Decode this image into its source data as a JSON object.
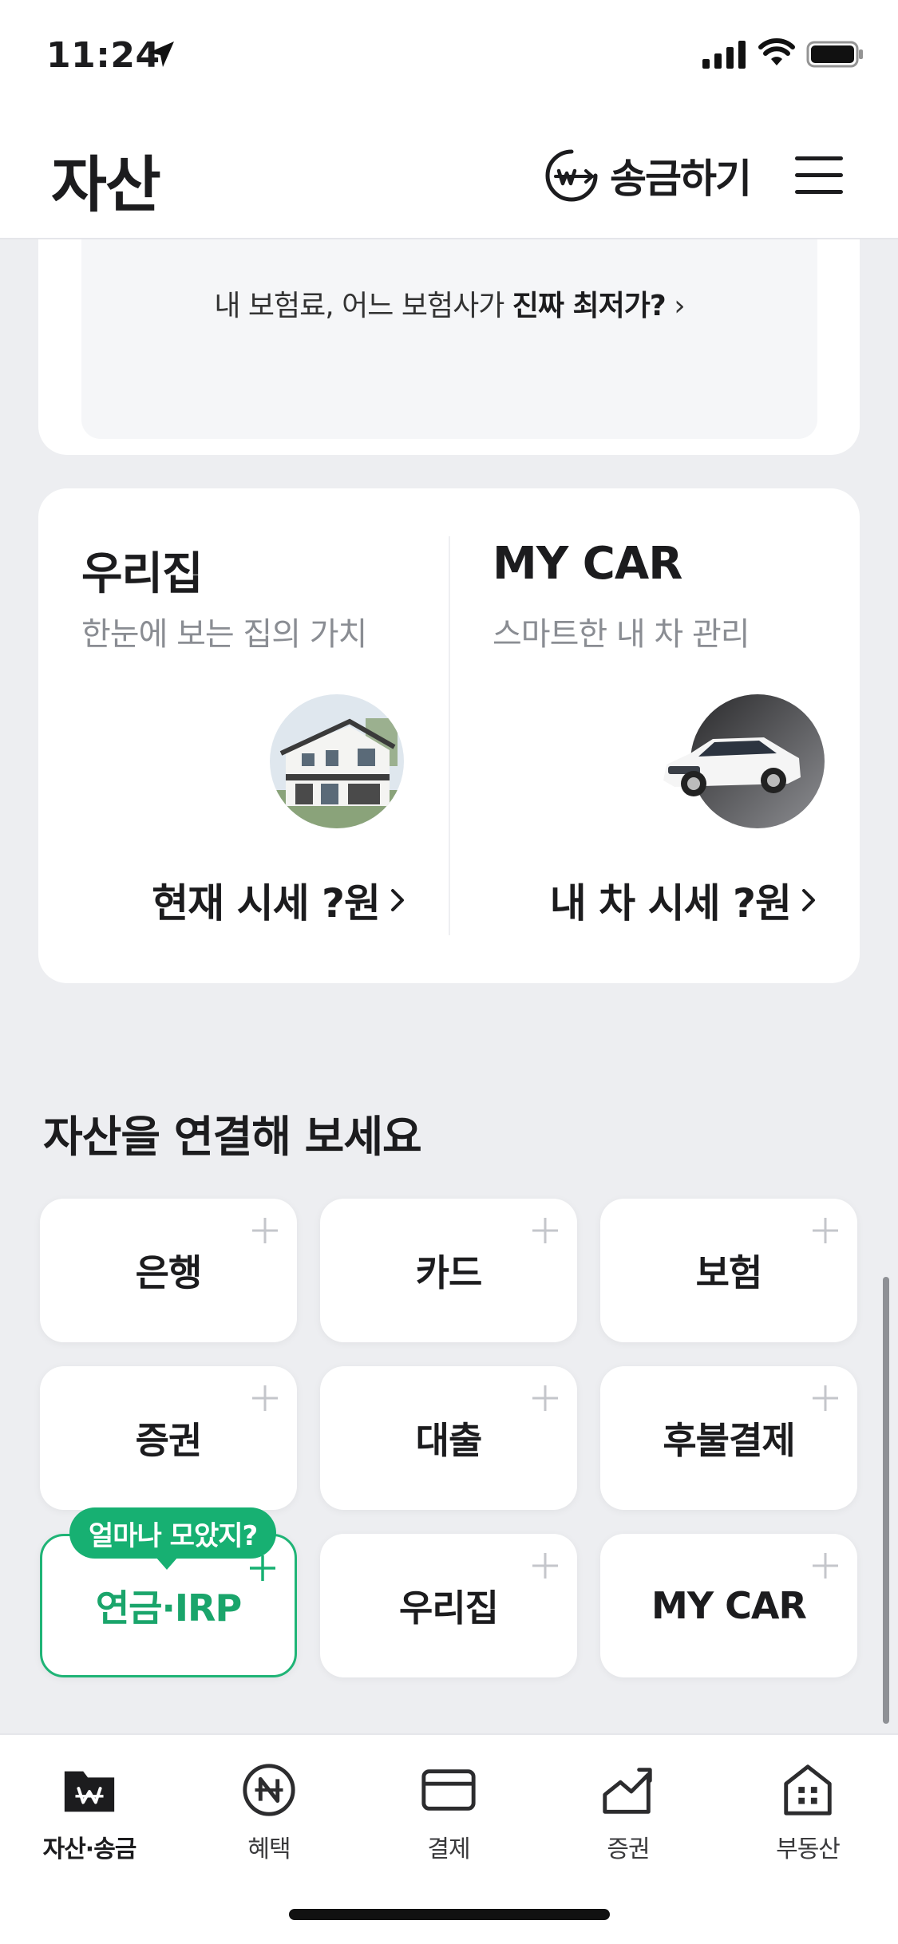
{
  "status_bar": {
    "time": "11:24"
  },
  "header": {
    "title": "자산",
    "transfer_label": "송금하기"
  },
  "insurance": {
    "prompt_normal": "내 보험료, 어느 보험사가 ",
    "prompt_bold": "진짜 최저가?"
  },
  "home_car": {
    "home": {
      "title": "우리집",
      "subtitle": "한눈에 보는 집의 가치",
      "price": "현재 시세 ?원"
    },
    "car": {
      "title": "MY CAR",
      "subtitle": "스마트한 내 차 관리",
      "price": "내 차 시세 ?원"
    }
  },
  "connect": {
    "title": "자산을 연결해 보세요",
    "tiles": [
      "은행",
      "카드",
      "보험",
      "증권",
      "대출",
      "후불결제",
      "연금·IRP",
      "우리집",
      "MY CAR"
    ],
    "highlight_badge": "얼마나 모았지?"
  },
  "tabbar": {
    "items": [
      "자산·송금",
      "혜택",
      "결제",
      "증권",
      "부동산"
    ]
  },
  "colors": {
    "accent_green": "#17b072",
    "text_dark": "#1c1c1e"
  }
}
